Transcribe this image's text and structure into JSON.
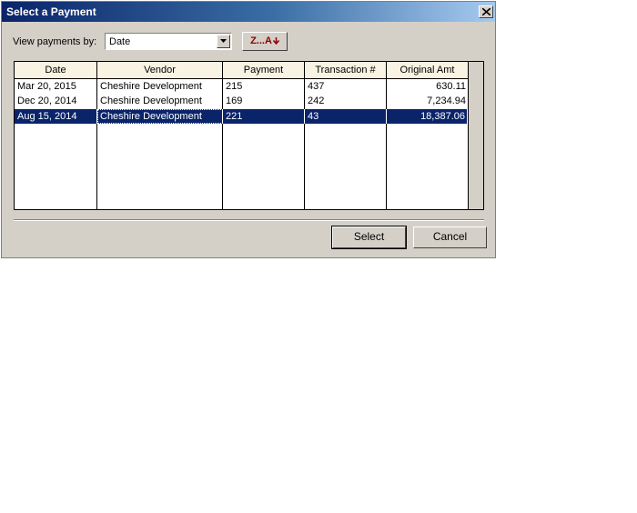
{
  "window": {
    "title": "Select a Payment"
  },
  "filter": {
    "label": "View payments by:",
    "selected": "Date",
    "sort_label": "Z...A"
  },
  "table": {
    "columns": [
      "Date",
      "Vendor",
      "Payment",
      "Transaction #",
      "Original Amt"
    ],
    "rows": [
      {
        "date": "Mar 20, 2015",
        "vendor": "Cheshire Development",
        "payment": "215",
        "transaction": "437",
        "amount": "630.11",
        "selected": false
      },
      {
        "date": "Dec 20, 2014",
        "vendor": "Cheshire Development",
        "payment": "169",
        "transaction": "242",
        "amount": "7,234.94",
        "selected": false
      },
      {
        "date": "Aug 15, 2014",
        "vendor": "Cheshire Development",
        "payment": "221",
        "transaction": "43",
        "amount": "18,387.06",
        "selected": true
      }
    ]
  },
  "buttons": {
    "select": "Select",
    "cancel": "Cancel"
  },
  "colors": {
    "title_bar": "#0a246a",
    "selection": "#0a246a",
    "header_bg": "#f9f3e3",
    "sort_accent": "#8b0000",
    "dialog_bg": "#d4d0c8"
  },
  "icons": {
    "close": "close-icon",
    "dropdown": "chevron-down-icon",
    "sort_arrow": "arrow-down-icon"
  }
}
